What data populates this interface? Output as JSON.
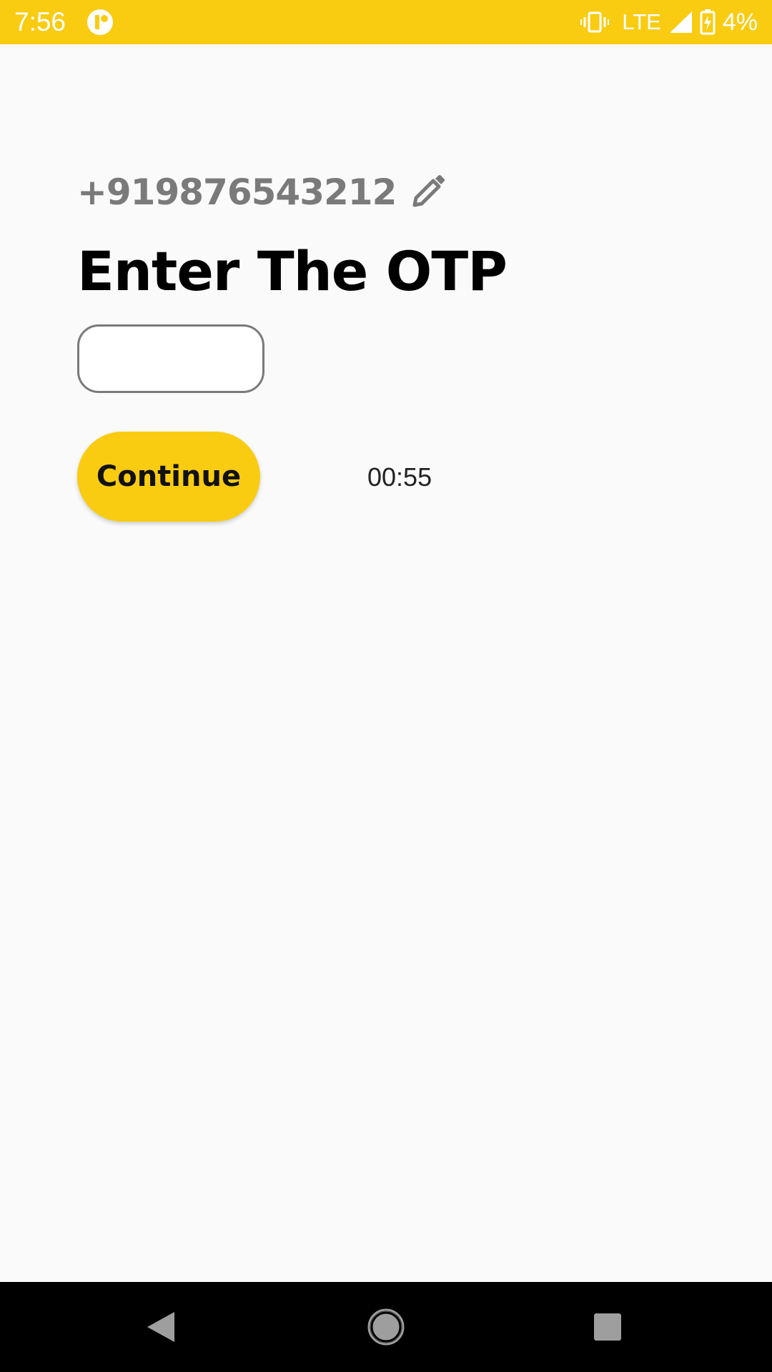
{
  "status_bar": {
    "time": "7:56",
    "network": "LTE",
    "battery": "4%"
  },
  "login": {
    "phone_number": "+919876543212",
    "heading": "Enter The OTP",
    "otp_value": "",
    "continue_label": "Continue",
    "timer": "00:55"
  },
  "theme": {
    "accent": "#f9cc12",
    "background": "#fafafa",
    "muted_text": "#7a7a7a"
  },
  "icons": {
    "edit": "pencil-icon",
    "back": "back-triangle-icon",
    "home": "home-circle-icon",
    "recents": "recents-square-icon"
  }
}
